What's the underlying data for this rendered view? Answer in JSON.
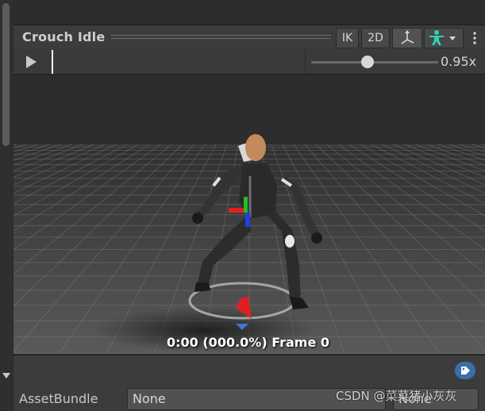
{
  "clip": {
    "title": "Crouch Idle"
  },
  "header_buttons": {
    "ik": "IK",
    "two_d": "2D"
  },
  "playback": {
    "speed_label": "0.95x",
    "speed_value": 0.95
  },
  "viewport": {
    "frame_label": "0:00 (000.0%) Frame 0"
  },
  "asset_bundle": {
    "label": "AssetBundle",
    "name_value": "None",
    "variant_value": "None"
  },
  "watermark": "CSDN @菜菜猪小灰灰",
  "icons": [
    "pivot-axis-icon",
    "avatar-humanoid-icon",
    "dropdown-arrow-icon",
    "kebab-menu-icon",
    "play-icon",
    "tag-icon"
  ],
  "colors": {
    "avatar_icon": "#2fd0b8",
    "tag_badge": "#3a6fa8",
    "x_axis": "#e02020",
    "y_axis": "#20c020",
    "z_axis": "#2040e0"
  }
}
